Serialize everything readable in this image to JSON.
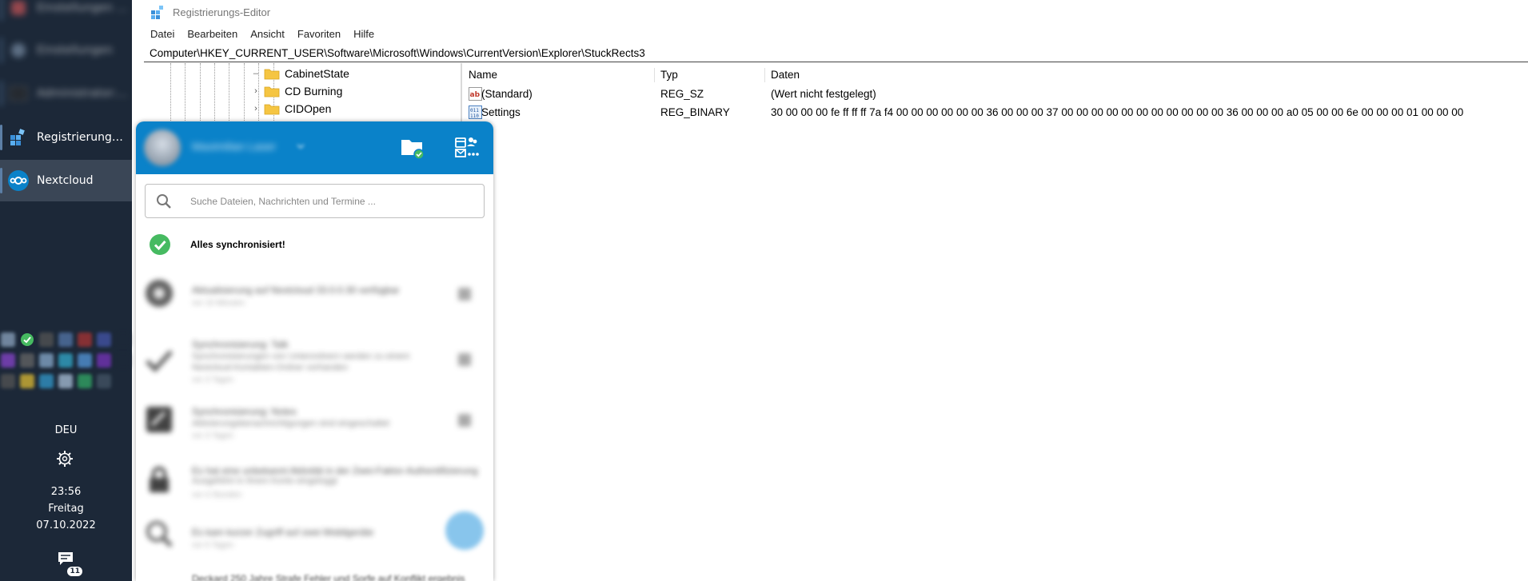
{
  "taskbar": {
    "apps": [
      {
        "label": "Einstellungen Prot…",
        "blurred": true
      },
      {
        "label": "Einstellungen",
        "blurred": true
      },
      {
        "label": "Administrator: E…",
        "blurred": true
      },
      {
        "label": "Registrierungs-E…",
        "blurred": false
      },
      {
        "label": "Nextcloud",
        "blurred": false,
        "active": true
      }
    ],
    "language": "DEU",
    "time": "23:56",
    "weekday": "Freitag",
    "date": "07.10.2022",
    "notification_count": "11"
  },
  "regedit": {
    "title": "Registrierungs-Editor",
    "menu": [
      "Datei",
      "Bearbeiten",
      "Ansicht",
      "Favoriten",
      "Hilfe"
    ],
    "path": "Computer\\HKEY_CURRENT_USER\\Software\\Microsoft\\Windows\\CurrentVersion\\Explorer\\StuckRects3",
    "tree": [
      {
        "label": "CabinetState",
        "expandable": false
      },
      {
        "label": "CD Burning",
        "expandable": true
      },
      {
        "label": "CIDOpen",
        "expandable": true
      }
    ],
    "columns": {
      "name": "Name",
      "type": "Typ",
      "data": "Daten"
    },
    "values": [
      {
        "name": "(Standard)",
        "type": "REG_SZ",
        "data": "(Wert nicht festgelegt)",
        "icon": "string-value-icon"
      },
      {
        "name": "Settings",
        "type": "REG_BINARY",
        "data": "30 00 00 00 fe ff ff ff 7a f4 00 00 00 00 00 00 36 00 00 00 37 00 00 00 00 00 00 00 00 00 00 00 36 00 00 00 a0 05 00 00 6e 00 00 00 01 00 00 00",
        "icon": "binary-value-icon"
      }
    ]
  },
  "nextcloud": {
    "user_name": "Maximilian Laser",
    "search_placeholder": "Suche Dateien, Nachrichten und Termine ...",
    "sync_status": "Alles synchronisiert!",
    "activities": [
      {
        "title": "Aktualisierung auf Nextcloud 33.0.0.30 verfügbar",
        "subtitle": "",
        "time": "vor 10 Minuten"
      },
      {
        "title": "Synchronisierung: Talk",
        "subtitle": "Synchronisierungen von Unterordnern werden zu einem",
        "subtitle2": "Nextcloud-Kontakten-Ordner vorhanden",
        "time": "vor 3 Tagen"
      },
      {
        "title": "Synchronisierung: Notes",
        "subtitle": "Aktivierungsbenachrichtigungen sind eingeschaltet",
        "time": "vor 3 Tagen"
      },
      {
        "title": "Es hat eine unbekannt Aktivität in der Zwei-Faktor-Authentifizierung",
        "subtitle": "Ausgeführt in Ihrem Konto eingeloggt",
        "time": "vor 4 Stunden"
      },
      {
        "title": "Es kam kurzer Zugriff auf zwei Mobilgeräte",
        "subtitle": "",
        "time": "vor 5 Tagen"
      }
    ],
    "bottom_text": "Deckard 250 Jahre Strafe Fehler und Sorfe auf Konflikt ergebnis"
  },
  "colors": {
    "taskbar_bg": "#1c2838",
    "nextcloud_blue": "#0a82c9",
    "sync_ok_green": "#46ba61",
    "folder_yellow": "#f5c542"
  }
}
